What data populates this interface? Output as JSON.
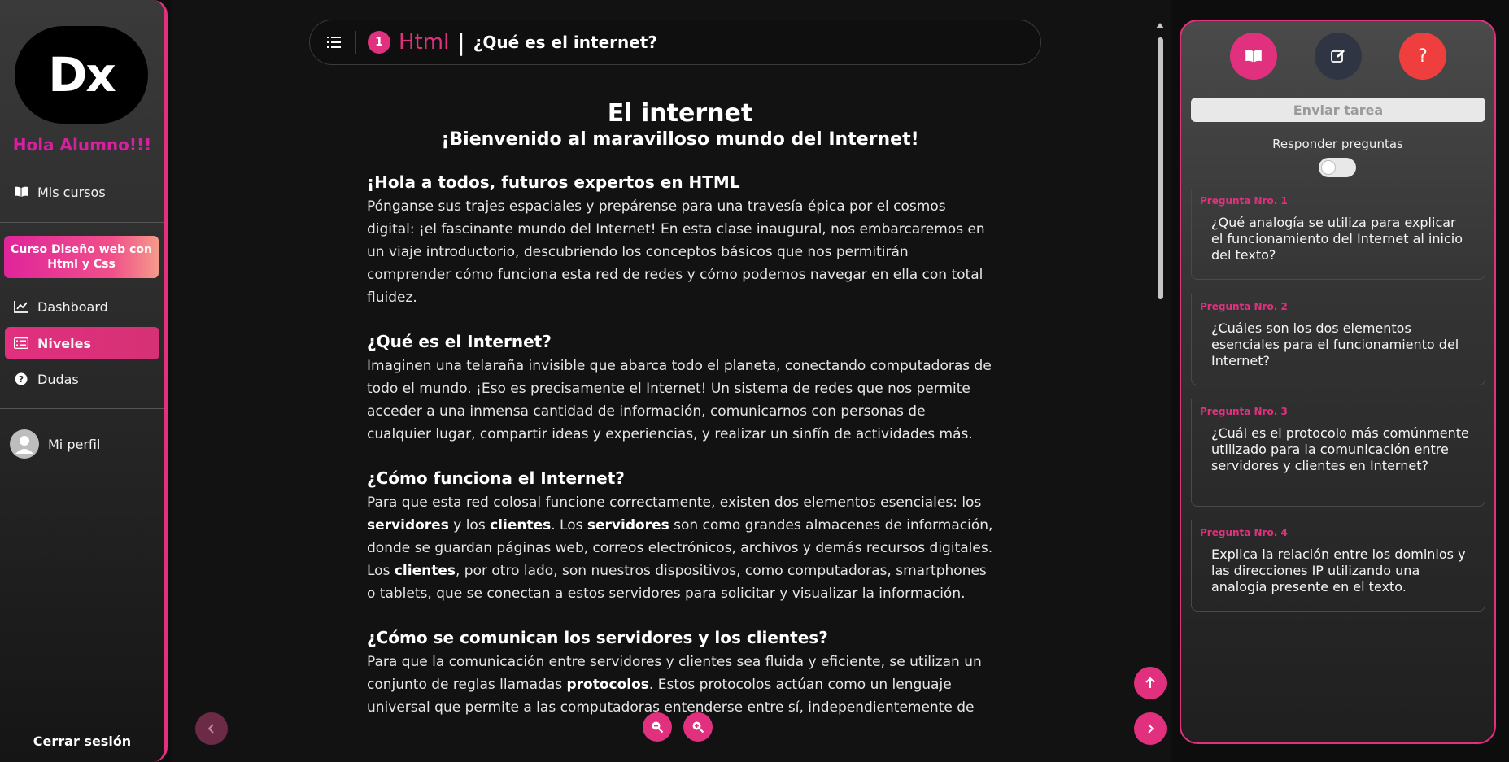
{
  "sidebar": {
    "logo": "Dx",
    "greeting": "Hola Alumno!!!",
    "my_courses": "Mis cursos",
    "course_card": "Curso Diseño web con Html y Css",
    "items": [
      {
        "label": "Dashboard",
        "icon": "chart-line-icon"
      },
      {
        "label": "Niveles",
        "icon": "list-icon",
        "active": true
      },
      {
        "label": "Dudas",
        "icon": "question-circle-icon"
      }
    ],
    "profile": "Mi perfil",
    "logout": "Cerrar sesión"
  },
  "topbar": {
    "number": "1",
    "course": "Html",
    "separator": "|",
    "title": "¿Qué es el internet?"
  },
  "content": {
    "title": "El internet",
    "subtitle": "¡Bienvenido al maravilloso mundo del Internet!",
    "s1_title": "¡Hola a todos, futuros expertos en HTML",
    "s1_text": "Pónganse sus trajes espaciales y prepárense para una travesía épica por el cosmos digital: ¡el fascinante mundo del Internet! En esta clase inaugural, nos embarcaremos en un viaje introductorio, descubriendo los conceptos básicos que nos permitirán comprender cómo funciona esta red de redes y cómo podemos navegar en ella con total fluidez.",
    "s2_title": "¿Qué es el Internet?",
    "s2_text": "Imaginen una telaraña invisible que abarca todo el planeta, conectando computadoras de todo el mundo. ¡Eso es precisamente el Internet! Un sistema de redes que nos permite acceder a una inmensa cantidad de información, comunicarnos con personas de cualquier lugar, compartir ideas y experiencias, y realizar un sinfín de actividades más.",
    "s3_title": "¿Cómo funciona el Internet?",
    "s3_a": "Para que esta red colosal funcione correctamente, existen dos elementos esenciales: los ",
    "s3_b1": "servidores",
    "s3_c": " y los ",
    "s3_b2": "clientes",
    "s3_d": ". Los ",
    "s3_b3": "servidores",
    "s3_e": " son como grandes almacenes de información, donde se guardan páginas web, correos electrónicos, archivos y demás recursos digitales. Los ",
    "s3_b4": "clientes",
    "s3_f": ", por otro lado, son nuestros dispositivos, como computadoras, smartphones o tablets, que se conectan a estos servidores para solicitar y visualizar la información.",
    "s4_title": "¿Cómo se comunican los servidores y los clientes?",
    "s4_a": "Para que la comunicación entre servidores y clientes sea fluida y eficiente, se utilizan un conjunto de reglas llamadas ",
    "s4_b": "protocolos",
    "s4_c": ". Estos protocolos actúan como un lenguaje universal que permite a las computadoras entenderse entre sí, independientemente de"
  },
  "panel": {
    "send_task": "Enviar tarea",
    "respond_label": "Responder preguntas",
    "questions": [
      {
        "label": "Pregunta Nro. 1",
        "text": "¿Qué analogía se utiliza para explicar el funcionamiento del Internet al inicio del texto?"
      },
      {
        "label": "Pregunta Nro. 2",
        "text": "¿Cuáles son los dos elementos esenciales para el funcionamiento del Internet?"
      },
      {
        "label": "Pregunta Nro. 3",
        "text": "¿Cuál es el protocolo más comúnmente utilizado para la comunicación entre servidores y clientes en Internet?"
      },
      {
        "label": "Pregunta Nro. 4",
        "text": "Explica la relación entre los dominios y las direcciones IP utilizando una analogía presente en el texto."
      }
    ]
  },
  "colors": {
    "accent": "#e0307e",
    "danger": "#ef3e3e",
    "dark_button": "#2f3542"
  }
}
